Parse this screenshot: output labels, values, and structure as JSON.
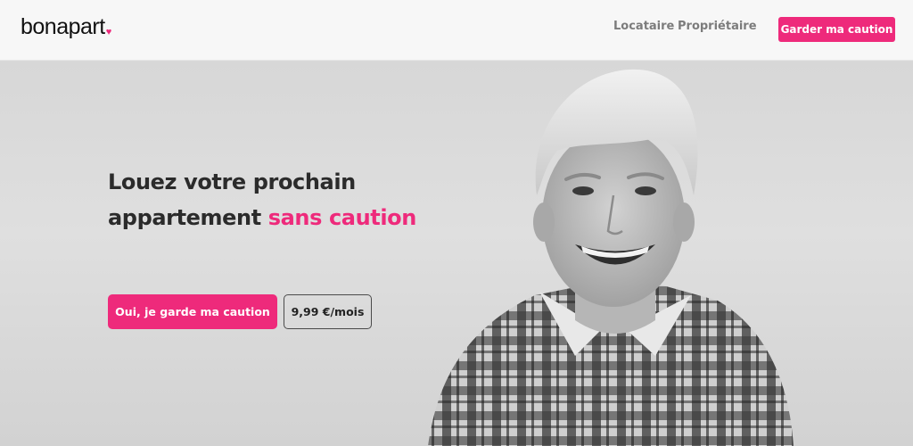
{
  "header": {
    "logo": "bonapart",
    "logo_mark": "♥",
    "nav": [
      {
        "label": "Locataire"
      },
      {
        "label": "Propriétaire"
      }
    ],
    "cta_label": "Garder ma caution"
  },
  "hero": {
    "headline_line1": "Louez votre prochain",
    "headline_line2_start": "appartement ",
    "headline_accent": "sans caution",
    "cta_label": "Oui, je garde ma caution",
    "price": "9,99 €/mois",
    "photo_icon": "woman-portrait-photo"
  },
  "colors": {
    "accent": "#ee2a7b",
    "header_bg": "#f7f7f7",
    "hero_bg": "#d8d8d8"
  }
}
